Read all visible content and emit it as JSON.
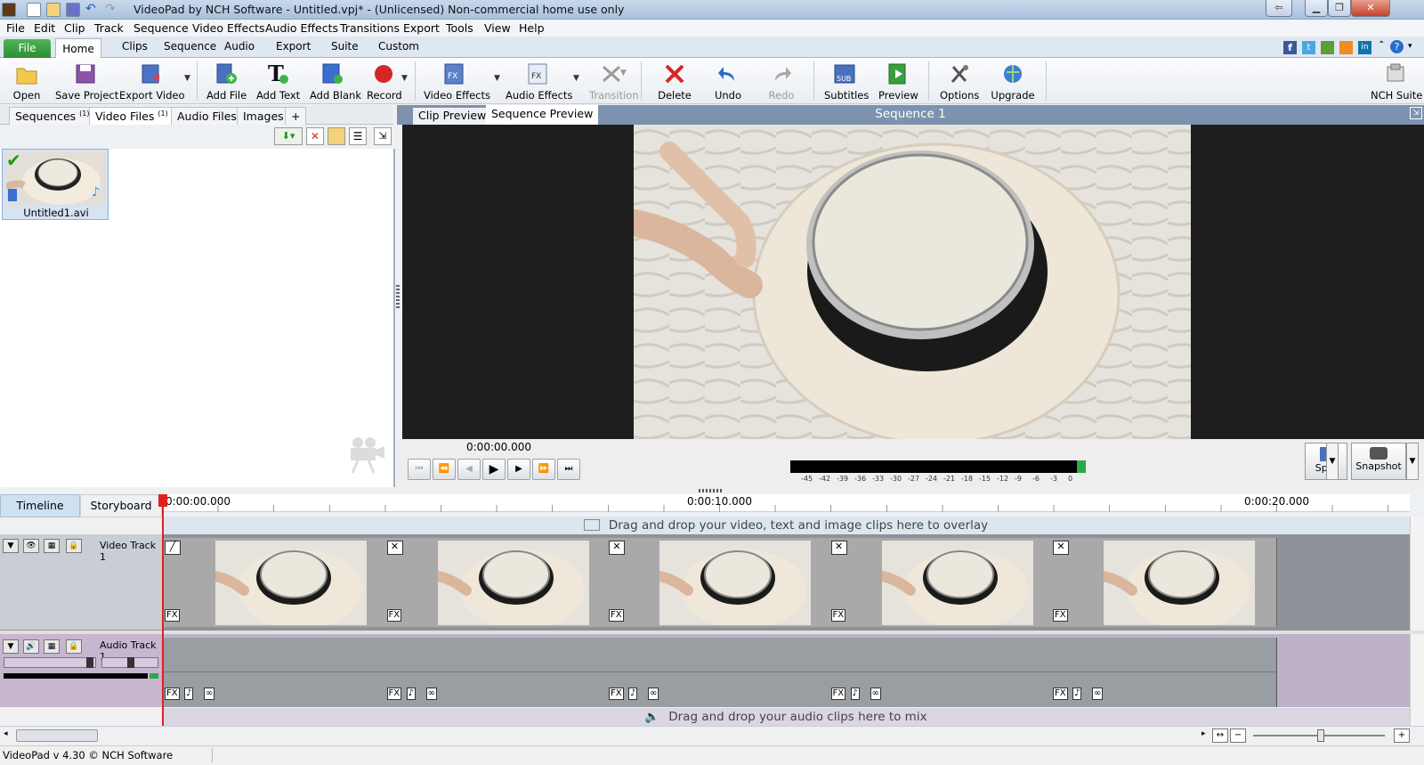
{
  "window": {
    "title": "VideoPad by NCH Software - Untitled.vpj* - (Unlicensed) Non-commercial home use only"
  },
  "menu": [
    "File",
    "Edit",
    "Clip",
    "Track",
    "Sequence",
    "Video Effects",
    "Audio Effects",
    "Transitions",
    "Export",
    "Tools",
    "View",
    "Help"
  ],
  "ribbon_tabs": [
    "File",
    "Home",
    "Clips",
    "Sequence",
    "Audio",
    "Export",
    "Suite",
    "Custom"
  ],
  "toolbar": {
    "open": "Open",
    "save_project": "Save Project",
    "export_video": "Export Video",
    "add_file": "Add File",
    "add_text": "Add Text",
    "add_blank": "Add Blank",
    "record": "Record",
    "video_effects": "Video Effects",
    "audio_effects": "Audio Effects",
    "transition": "Transition",
    "delete": "Delete",
    "undo": "Undo",
    "redo": "Redo",
    "subtitles": "Subtitles",
    "preview": "Preview",
    "options": "Options",
    "upgrade": "Upgrade",
    "nch_suite": "NCH Suite",
    "sub_icon_text": "SUB"
  },
  "bin": {
    "tabs": [
      {
        "label": "Sequences",
        "count": "(1)"
      },
      {
        "label": "Video Files",
        "count": "(1)"
      },
      {
        "label": "Audio Files",
        "count": ""
      },
      {
        "label": "Images",
        "count": ""
      },
      {
        "label": "+",
        "count": ""
      }
    ],
    "file_name": "Untitled1.avi"
  },
  "preview": {
    "tab_clip": "Clip Preview",
    "tab_sequence": "Sequence Preview",
    "sequence_title": "Sequence 1",
    "timecode": "0:00:00.000",
    "split": "Split",
    "snapshot": "Snapshot",
    "meter_labels": [
      "-45",
      "-42",
      "-39",
      "-36",
      "-33",
      "-30",
      "-27",
      "-24",
      "-21",
      "-18",
      "-15",
      "-12",
      "-9",
      "-6",
      "-3",
      "0"
    ]
  },
  "timeline": {
    "tab_timeline": "Timeline",
    "tab_storyboard": "Storyboard",
    "ruler": [
      "0:00:00.000",
      "0:00:10.000",
      "0:00:20.000"
    ],
    "overlay_hint": "Drag and drop your video, text and image clips here to overlay",
    "video_track": "Video Track 1",
    "audio_track": "Audio Track 1",
    "audio_hint": "Drag and drop your audio clips here to mix",
    "fx": "FX",
    "clip_count": 5
  },
  "status": {
    "text": "VideoPad v 4.30 © NCH Software"
  },
  "colors": {
    "file_tab": "#3a9e40",
    "playhead": "#e02020",
    "preview_bg": "#1e1e1e"
  }
}
